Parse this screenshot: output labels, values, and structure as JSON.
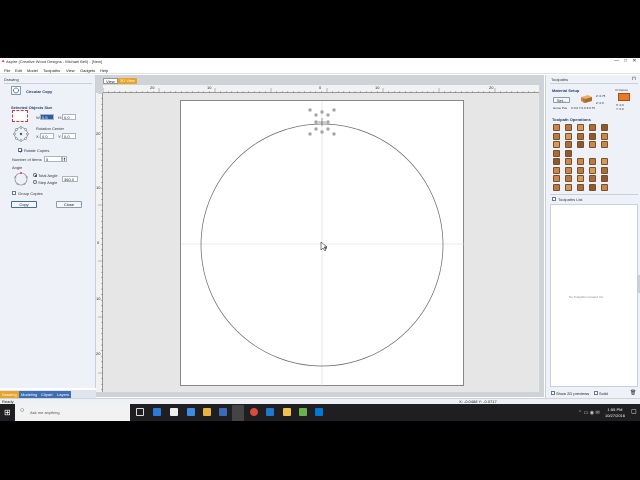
{
  "window": {
    "title": "Aspire (Creative Wood Designs - Michael Bell) - [New]",
    "minimize": "—",
    "maximize": "□",
    "close": "✕"
  },
  "menu": [
    "File",
    "Edit",
    "Model",
    "Toolpaths",
    "View",
    "Gadgets",
    "Help"
  ],
  "left_panel": {
    "header": "Drawing",
    "tool_title": "Circular Copy",
    "selected_size_title": "Selected Objects Size",
    "w_label": "W:",
    "w_value": "0.5",
    "h_label": "H:",
    "h_value": "0.0",
    "rotation_center_label": "Rotation Center",
    "x_label": "X:",
    "x_value": "0.0",
    "y_label": "Y:",
    "y_value": "0.0",
    "rotate_copies_label": "Rotate Copies",
    "number_of_items_label": "Number of Items",
    "number_of_items_value": "5",
    "angle_label": "Angle",
    "total_angle_label": "Total Angle",
    "total_angle_value": "360.0",
    "step_angle_label": "Step Angle",
    "group_copies_label": "Group Copies",
    "copy_button": "Copy",
    "close_button": "Close"
  },
  "bottom_tabs": [
    "Drawing",
    "Modeling",
    "Clipart",
    "Layers"
  ],
  "doc_tabs": [
    "View",
    "3D View"
  ],
  "ruler_top_labels": [
    "20",
    "10",
    "0",
    "10",
    "20"
  ],
  "ruler_left_labels": [
    "20",
    "10",
    "0",
    "10",
    "20"
  ],
  "status": {
    "left": "Ready",
    "coords": "X: -0.0488 Y: -0.0717"
  },
  "right_panel": {
    "header": "Toolpaths",
    "material_setup": "Material Setup",
    "set_button": "Set...",
    "z_labels": [
      "Z: 0.0",
      "Z: 0.75"
    ],
    "home_label": "Home Pos",
    "home_value": "X:0.0 Y:0.0 Z:0.75",
    "deluxe_label": "VI Deluxe",
    "deluxe_value": "X: 0.0\nY: 0.0",
    "toolpath_ops": "Toolpath Operations",
    "toolpath_list": "Toolpaths List",
    "no_toolpaths": "No Toolpaths Created Yet",
    "show_2d": "Show 2D previews",
    "solid": "Solid"
  },
  "taskbar": {
    "search_placeholder": "Ask me anything",
    "time": "1:55 PM",
    "date": "10/27/2016"
  },
  "colors": {
    "accent": "#1e3d6e",
    "tab_orange": "#e8a32a",
    "tab_blue": "#3e6eb4",
    "taskbar": "#1f1f22",
    "sheet_circle": "#666666"
  }
}
